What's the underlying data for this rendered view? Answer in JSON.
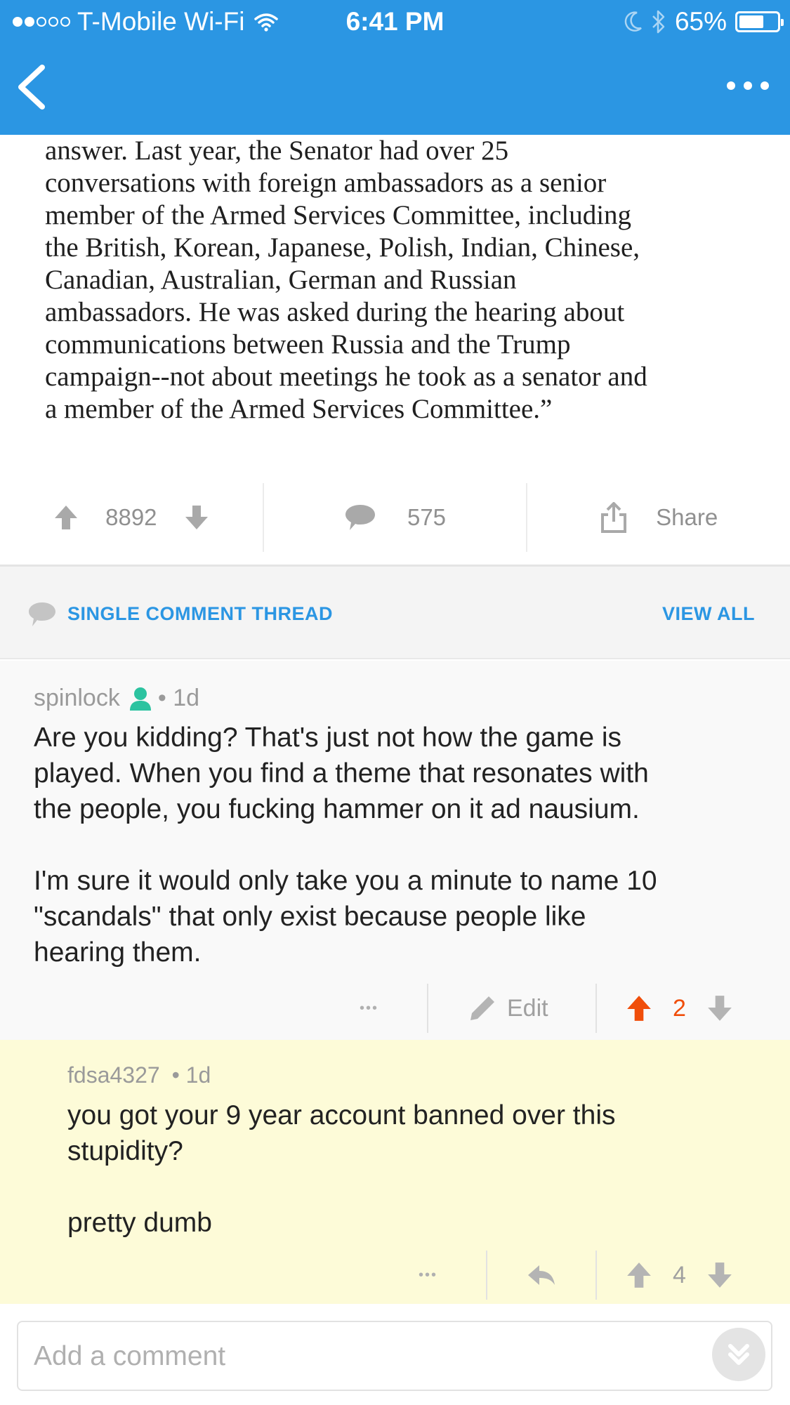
{
  "status_bar": {
    "carrier": "T-Mobile Wi-Fi",
    "time": "6:41 PM",
    "battery": "65%",
    "battery_level": 0.65
  },
  "post": {
    "quote_lines": [
      "answer. Last year, the Senator had over 25",
      "conversations with foreign ambassadors as a senior",
      "member of the Armed Services Committee, including",
      "the British, Korean, Japanese, Polish, Indian, Chinese,",
      "Canadian, Australian, German and Russian",
      "ambassadors. He was asked during the hearing about",
      "communications between Russia and the Trump",
      "campaign--not about meetings he took as a senator and",
      "a member of the Armed Services Committee.”"
    ],
    "score": "8892",
    "comment_count": "575",
    "share_label": "Share"
  },
  "thread": {
    "title": "SINGLE COMMENT THREAD",
    "view_all": "VIEW ALL"
  },
  "comments": [
    {
      "author": "spinlock",
      "age": "• 1d",
      "body_lines": [
        "Are you kidding? That's just not how the game is",
        "played. When you find a theme that resonates with",
        "the people, you fucking hammer on it ad nausium.",
        "",
        "I'm sure it would only take you a minute to name 10",
        "\"scandals\" that only exist because people like",
        "hearing them."
      ],
      "more": "•••",
      "edit_label": "Edit",
      "score": "2"
    },
    {
      "author": "fdsa4327",
      "age": "• 1d",
      "body_lines": [
        "you got your 9 year account banned over this",
        "stupidity?",
        "",
        "pretty dumb"
      ],
      "more": "•••",
      "score": "4"
    }
  ],
  "composer": {
    "placeholder": "Add a comment"
  },
  "colors": {
    "header_blue": "#2b96e3",
    "upvote_orange": "#f04e0a",
    "reply_highlight": "#fdfbd8",
    "op_badge_teal": "#2cc3a0"
  }
}
